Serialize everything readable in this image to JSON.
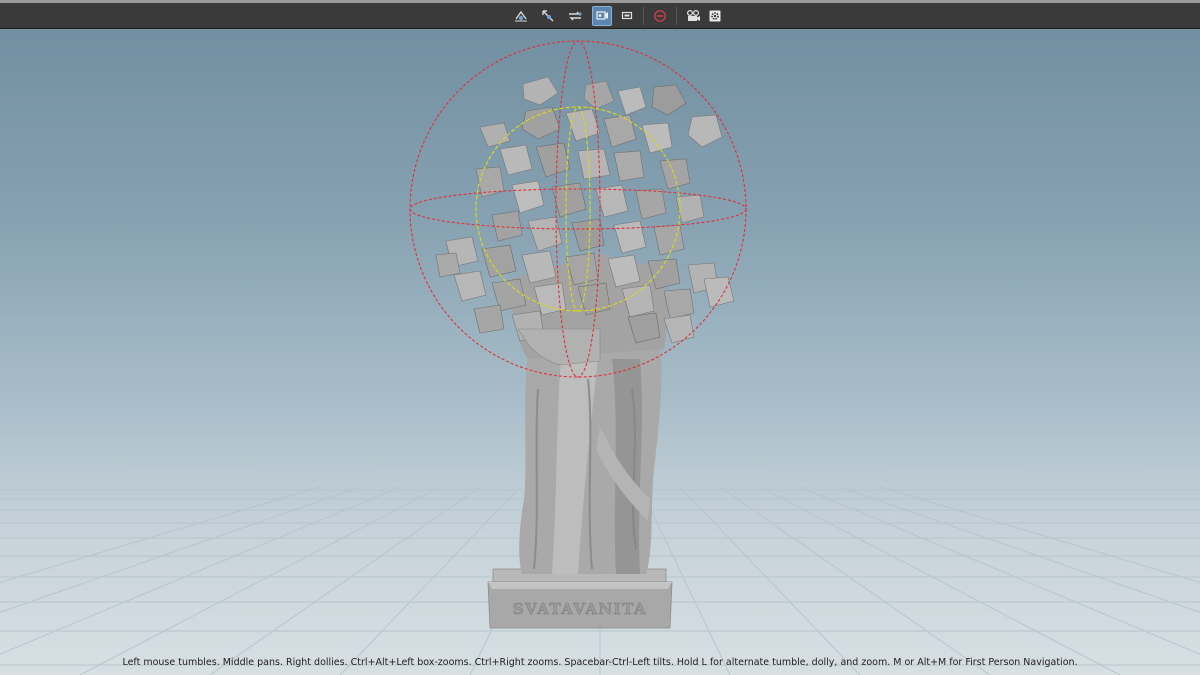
{
  "toolbar": {
    "buttons": [
      {
        "icon": "tumble-view-icon",
        "active": false
      },
      {
        "icon": "pan-view-icon",
        "active": false
      },
      {
        "icon": "dolly-view-icon",
        "active": false
      },
      {
        "icon": "scene-view-icon",
        "active": true
      },
      {
        "icon": "camera-screen-icon",
        "active": false
      },
      {
        "icon": "no-entry-icon",
        "active": false
      },
      {
        "icon": "camera-reel-icon",
        "active": false
      },
      {
        "icon": "gear-settings-icon",
        "active": false
      }
    ]
  },
  "scene": {
    "statue_inscription": "SVATAVANITA",
    "colors": {
      "guide_outer": "#e0303a",
      "guide_inner": "#d6d620",
      "statue": "#a9a9a9",
      "grid": "#b7c5cd"
    }
  },
  "status_bar": {
    "hint": "Left mouse tumbles. Middle pans. Right dollies. Ctrl+Alt+Left box-zooms. Ctrl+Right zooms. Spacebar-Ctrl-Left tilts. Hold L for alternate tumble, dolly, and zoom. M or Alt+M for First Person Navigation."
  }
}
